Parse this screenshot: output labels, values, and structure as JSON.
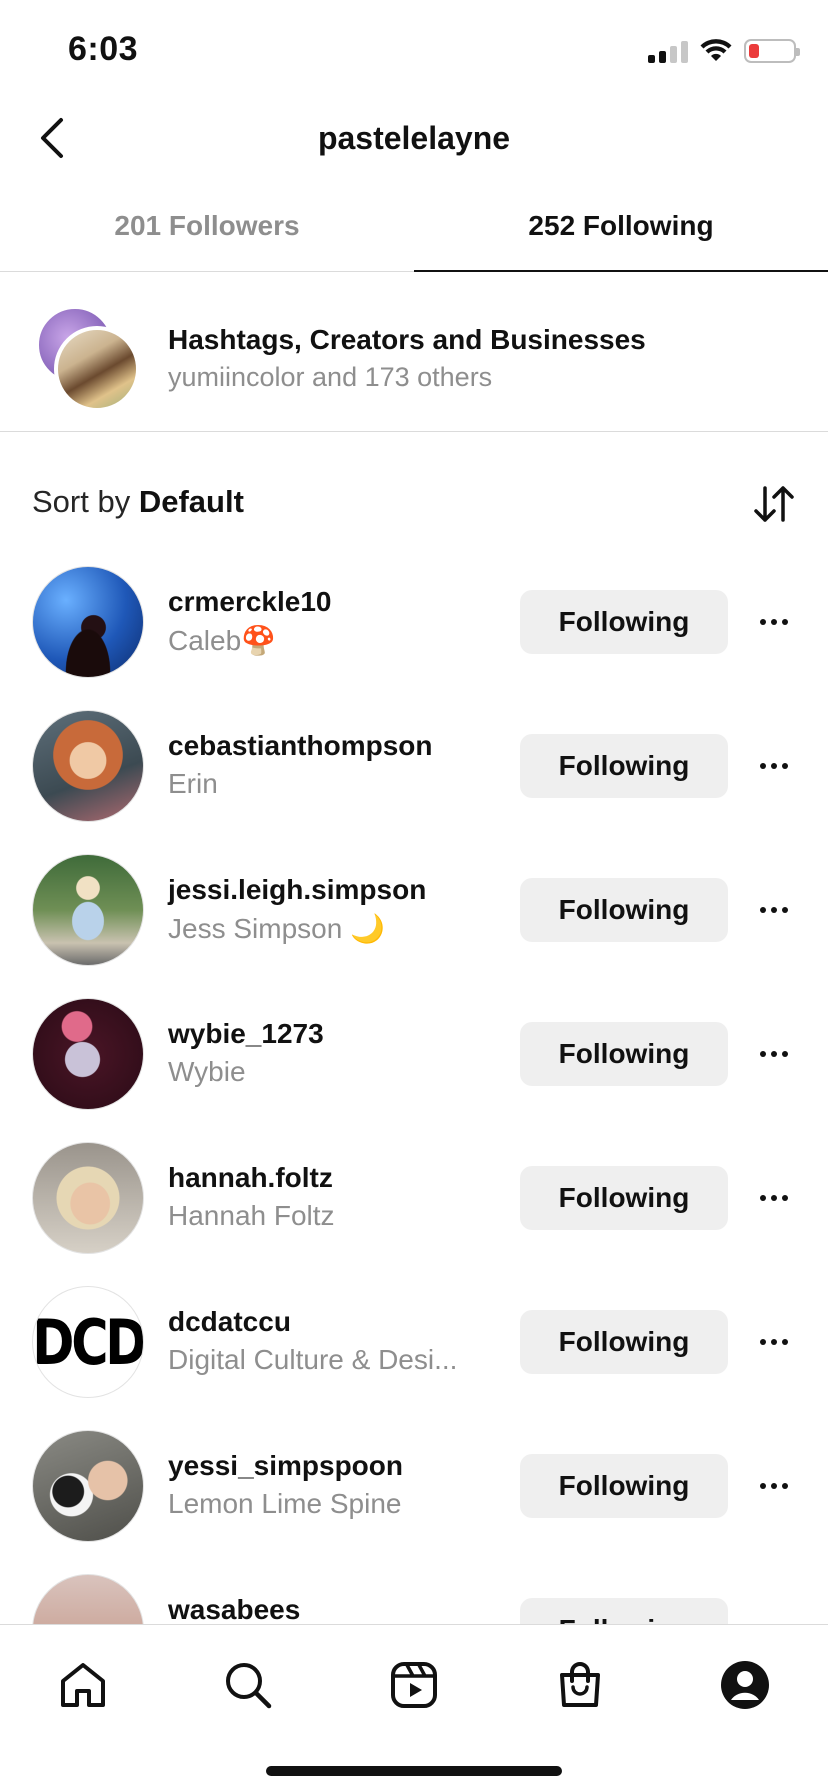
{
  "status_bar": {
    "time": "6:03"
  },
  "header": {
    "title": "pastelelayne"
  },
  "tabs": [
    {
      "label": "201 Followers",
      "active": false
    },
    {
      "label": "252 Following",
      "active": true
    }
  ],
  "hashtags": {
    "title": "Hashtags, Creators and Businesses",
    "subtitle": "yumiincolor and 173 others"
  },
  "sort": {
    "prefix": "Sort by",
    "value": "Default"
  },
  "list": {
    "items": [
      {
        "username": "crmerckle10",
        "fullname": "Caleb🍄",
        "button": "Following"
      },
      {
        "username": "cebastianthompson",
        "fullname": "Erin",
        "button": "Following"
      },
      {
        "username": "jessi.leigh.simpson",
        "fullname": "Jess Simpson 🌙",
        "button": "Following"
      },
      {
        "username": "wybie_1273",
        "fullname": "Wybie",
        "button": "Following"
      },
      {
        "username": "hannah.foltz",
        "fullname": "Hannah Foltz",
        "button": "Following"
      },
      {
        "username": "dcdatccu",
        "fullname": "Digital Culture & Desi...",
        "button": "Following",
        "avatar_text": "DCD"
      },
      {
        "username": "yessi_simpspoon",
        "fullname": "Lemon Lime Spine",
        "button": "Following"
      },
      {
        "username": "wasabees",
        "fullname": "",
        "button": "Following"
      }
    ]
  },
  "bottom_nav": {
    "items": [
      "home-icon",
      "search-icon",
      "reels-icon",
      "shop-icon",
      "profile-icon"
    ]
  },
  "colors": {
    "button_bg": "#efefef",
    "secondary_text": "#8e8e8e",
    "divider": "#dbdbdb",
    "battery_low": "#eb3b3b"
  }
}
